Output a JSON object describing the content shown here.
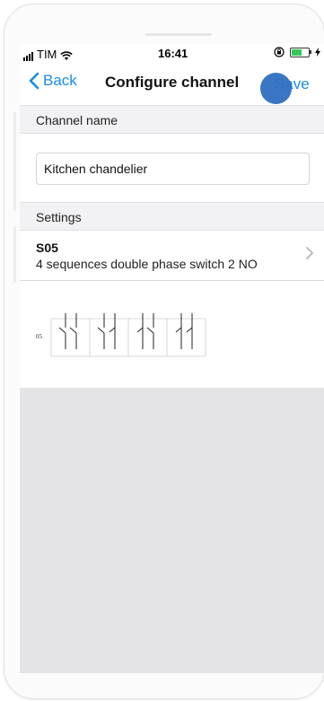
{
  "status_bar": {
    "carrier": "TIM",
    "time": "16:41",
    "icons": [
      "signal-bars-icon",
      "wifi-icon",
      "orientation-lock-icon",
      "battery-icon",
      "charging-icon"
    ],
    "battery_color": "#35c759"
  },
  "navbar": {
    "back_label": "Back",
    "title": "Configure channel",
    "save_label": "Save",
    "accent_color": "#1a8ce6"
  },
  "channel_name": {
    "header": "Channel name",
    "value": "Kitchen chandelier"
  },
  "settings": {
    "header": "Settings",
    "selected_code": "S05",
    "selected_description": "4 sequences double phase switch 2 NO"
  },
  "diagram": {
    "index_label": "05",
    "sequences": 4
  }
}
